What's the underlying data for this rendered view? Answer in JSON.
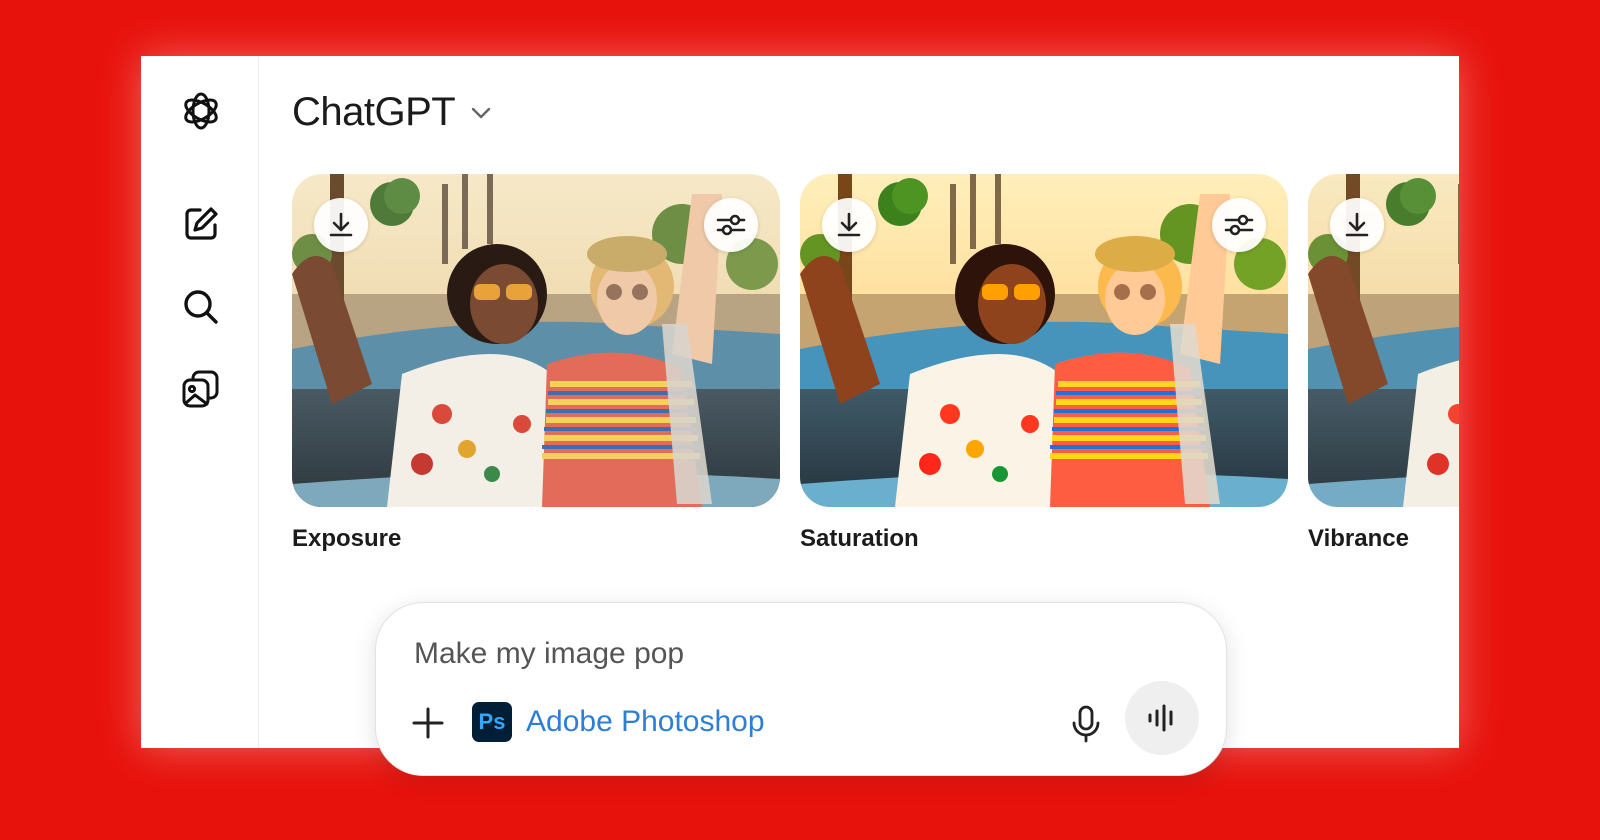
{
  "app": {
    "title": "ChatGPT"
  },
  "sidebar": {
    "icons": [
      "openai-logo-icon",
      "new-chat-icon",
      "search-icon",
      "images-icon"
    ]
  },
  "cards": [
    {
      "label": "Exposure",
      "variant": "exposure"
    },
    {
      "label": "Saturation",
      "variant": "saturation"
    },
    {
      "label": "Vibrance",
      "variant": "vibrance"
    }
  ],
  "composer": {
    "prompt": "Make my image pop",
    "app_badge": "Ps",
    "app_name": "Adobe Photoshop"
  },
  "colors": {
    "background": "#e8120c",
    "accent_link": "#2d7fd6",
    "ps_logo_bg": "#001e36",
    "ps_logo_fg": "#31a8ff"
  }
}
